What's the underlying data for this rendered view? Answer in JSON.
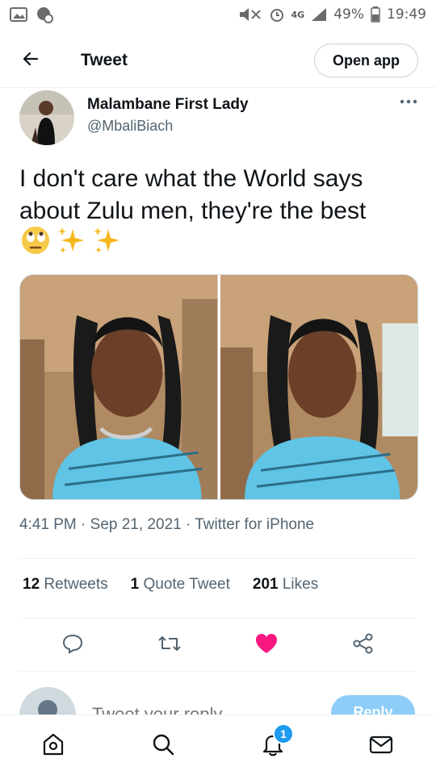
{
  "status_bar": {
    "network": "4G",
    "battery": "49%",
    "time": "19:49",
    "icons": [
      "gallery-icon",
      "notification-icon",
      "mute-icon",
      "alarm-icon",
      "signal-icon",
      "battery-icon"
    ]
  },
  "header": {
    "back_icon": "arrow-left-icon",
    "title": "Tweet",
    "open_app": "Open app"
  },
  "tweet": {
    "author": {
      "name": "Malambane First Lady",
      "handle": "@MbaliBiach"
    },
    "more_icon": "more-icon",
    "text": "I don't care what the World says about Zulu men, they're the best",
    "emojis": [
      "face-with-rolling-eyes-emoji",
      "sparkles-emoji",
      "sparkles-emoji"
    ],
    "time": "4:41 PM",
    "date": "Sep 21, 2021",
    "source": "Twitter for iPhone",
    "separator": "·"
  },
  "stats": {
    "retweets_count": "12",
    "retweets_label": "Retweets",
    "quotes_count": "1",
    "quotes_label": "Quote Tweet",
    "likes_count": "201",
    "likes_label": "Likes"
  },
  "actions": {
    "icons": [
      "reply-icon",
      "retweet-icon",
      "like-icon",
      "share-icon"
    ],
    "like_color": "#f91880"
  },
  "reply_bar": {
    "placeholder": "Tweet your reply",
    "button": "Reply"
  },
  "bottom_nav": {
    "items": [
      "home-icon",
      "search-icon",
      "notifications-icon",
      "messages-icon"
    ],
    "notifications_badge": "1"
  },
  "colors": {
    "accent": "#1d9bf0",
    "text": "#0f1419",
    "secondary": "#536471",
    "reply_button": "#8ecdf8"
  }
}
